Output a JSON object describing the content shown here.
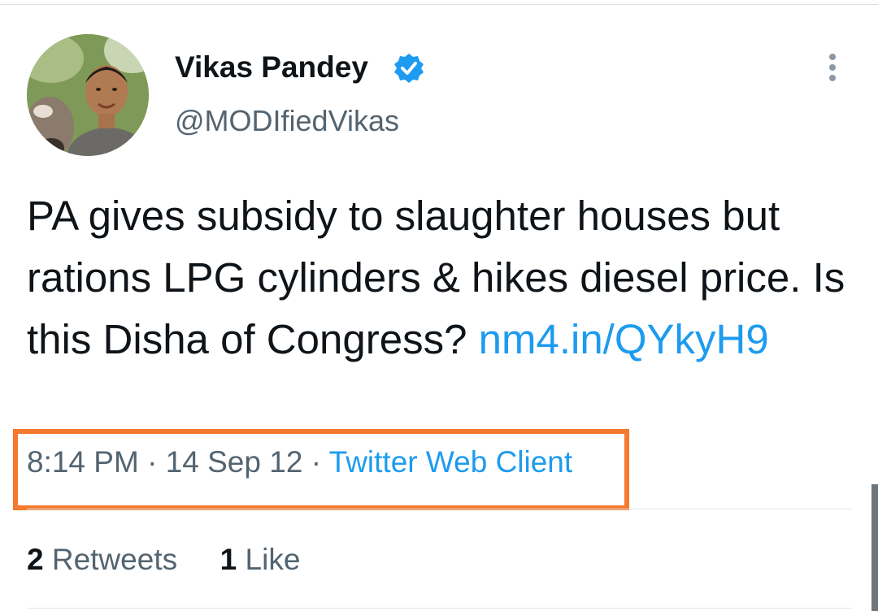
{
  "user": {
    "display_name": "Vikas Pandey",
    "handle": "@MODIfiedVikas",
    "verified": true,
    "avatar_icon": "profile-photo"
  },
  "tweet": {
    "text": "PA gives subsidy to slaughter houses but rations LPG cylinders & hikes diesel price. Is this Disha of Congress?",
    "link": "nm4.in/QYkyH9"
  },
  "meta": {
    "time": "8:14 PM",
    "separator": "·",
    "date": "14 Sep 12",
    "source": "Twitter Web Client"
  },
  "stats": {
    "retweets_count": "2",
    "retweets_label": "Retweets",
    "likes_count": "1",
    "likes_label": "Like"
  },
  "colors": {
    "link": "#1d9bf0",
    "secondary_text": "#536471",
    "highlight_border": "#f47a2d"
  }
}
